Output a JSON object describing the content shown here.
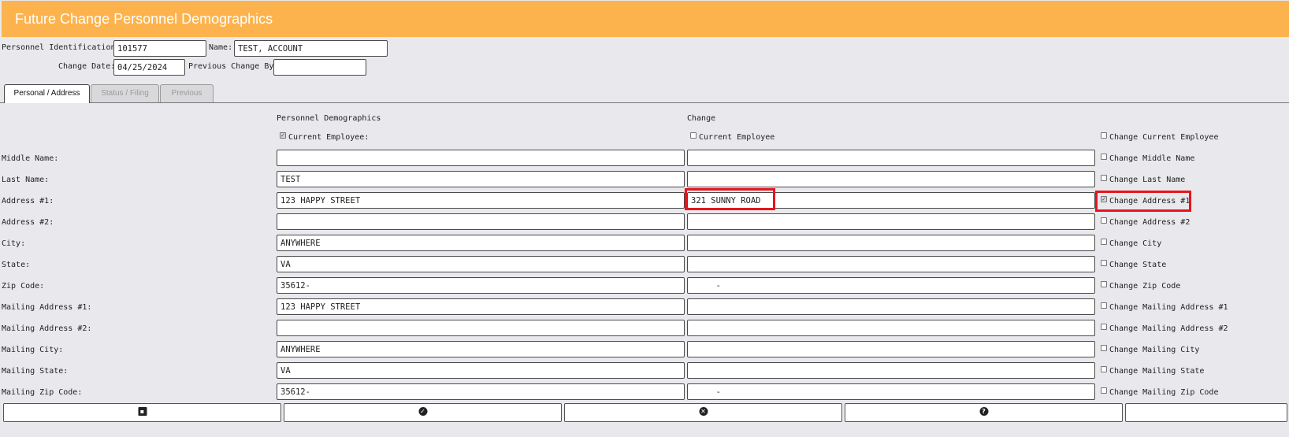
{
  "header": {
    "title": "Future Change Personnel Demographics"
  },
  "top_fields": {
    "personnel_id_label": "Personnel Identification:",
    "personnel_id_value": "101577",
    "name_label": "Name:",
    "name_value": "TEST, ACCOUNT",
    "change_date_label": "Change Date:",
    "change_date_value": "04/25/2024",
    "prev_change_by_label": "Previous Change By:",
    "prev_change_by_value": ""
  },
  "tabs": [
    {
      "label": "Personal / Address",
      "active": true
    },
    {
      "label": "Status / Filing",
      "active": false
    },
    {
      "label": "Previous",
      "active": false
    }
  ],
  "columns": {
    "current_header": "Personnel Demographics",
    "change_header": "Change",
    "current_employee_label": "Current Employee:",
    "current_employee_checked": true,
    "change_employee_label": "Current Employee",
    "change_employee_checked": false,
    "change_current_employee_label": "Change Current Employee",
    "change_current_employee_checked": false
  },
  "rows": [
    {
      "label": "Middle Name:",
      "current": "",
      "change": "",
      "toggle_label": "Change Middle Name",
      "toggle_checked": false
    },
    {
      "label": "Last Name:",
      "current": "TEST",
      "change": "",
      "toggle_label": "Change Last Name",
      "toggle_checked": false
    },
    {
      "label": "Address #1:",
      "current": "123 HAPPY STREET",
      "change": "321 SUNNY ROAD",
      "toggle_label": "Change Address #1",
      "toggle_checked": true
    },
    {
      "label": "Address #2:",
      "current": "",
      "change": "",
      "toggle_label": "Change Address #2",
      "toggle_checked": false
    },
    {
      "label": "City:",
      "current": "ANYWHERE",
      "change": "",
      "toggle_label": "Change City",
      "toggle_checked": false
    },
    {
      "label": "State:",
      "current": "VA",
      "change": "",
      "toggle_label": "Change State",
      "toggle_checked": false
    },
    {
      "label": "Zip Code:",
      "current": "35612-",
      "change": "     -",
      "toggle_label": "Change Zip Code",
      "toggle_checked": false
    },
    {
      "label": "Mailing Address #1:",
      "current": "123 HAPPY STREET",
      "change": "",
      "toggle_label": "Change Mailing Address #1",
      "toggle_checked": false
    },
    {
      "label": "Mailing Address #2:",
      "current": "",
      "change": "",
      "toggle_label": "Change Mailing Address #2",
      "toggle_checked": false
    },
    {
      "label": "Mailing City:",
      "current": "ANYWHERE",
      "change": "",
      "toggle_label": "Change Mailing City",
      "toggle_checked": false
    },
    {
      "label": "Mailing State:",
      "current": "VA",
      "change": "",
      "toggle_label": "Change Mailing State",
      "toggle_checked": false
    },
    {
      "label": "Mailing Zip Code:",
      "current": "35612-",
      "change": "     -",
      "toggle_label": "Change Mailing Zip Code",
      "toggle_checked": false
    }
  ],
  "buttons": [
    {
      "name": "save-button",
      "icon": "floppy-disk-icon"
    },
    {
      "name": "accept-button",
      "icon": "check-circle-icon"
    },
    {
      "name": "cancel-button",
      "icon": "x-circle-icon"
    },
    {
      "name": "help-button",
      "icon": "question-circle-icon"
    },
    {
      "name": "extra-button",
      "icon": ""
    }
  ],
  "colors": {
    "header": "#fdb34d",
    "highlight": "#e8141d",
    "background": "#e9e8ec"
  }
}
